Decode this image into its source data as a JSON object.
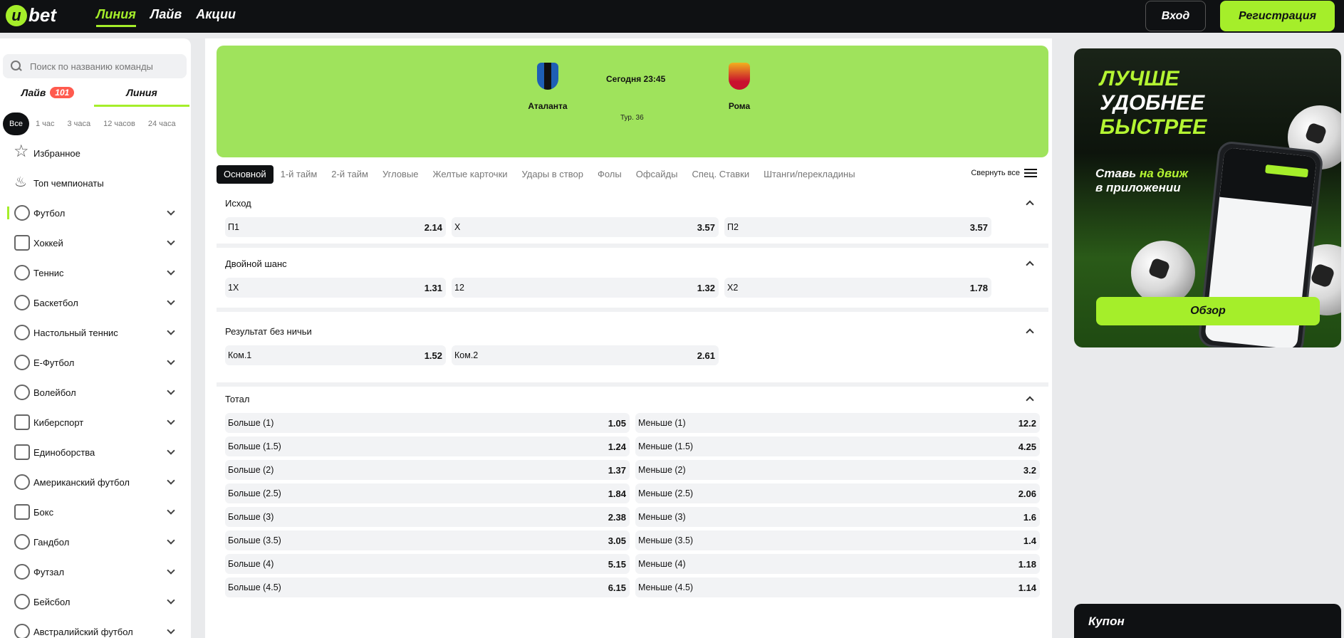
{
  "header": {
    "logo_text": "bet",
    "logo_letter": "u",
    "nav": [
      "Линия",
      "Лайв",
      "Акции"
    ],
    "login": "Вход",
    "register": "Регистрация"
  },
  "sidebar": {
    "search_placeholder": "Поиск по названию команды",
    "tab_live": "Лайв",
    "tab_live_count": "101",
    "tab_line": "Линия",
    "time_filters": [
      "Все",
      "1 час",
      "3 часа",
      "12 часов",
      "24 часа"
    ],
    "sports": [
      "Избранное",
      "Топ чемпионаты",
      "Футбол",
      "Хоккей",
      "Теннис",
      "Баскетбол",
      "Настольный теннис",
      "Е-Футбол",
      "Волейбол",
      "Киберспорт",
      "Единоборства",
      "Американский футбол",
      "Бокс",
      "Гандбол",
      "Футзал",
      "Бейсбол",
      "Австралийский футбол"
    ]
  },
  "match": {
    "home": "Аталанта",
    "away": "Рома",
    "time": "Сегодня 23:45",
    "round": "Тур. 36",
    "colors": {
      "banner": "#9fe35c",
      "home_crest": "#1e5fb5",
      "away_crest": "#c8102e"
    }
  },
  "market_tabs": [
    "Основной",
    "1-й тайм",
    "2-й тайм",
    "Угловые",
    "Желтые карточки",
    "Удары в створ",
    "Фолы",
    "Офсайды",
    "Спец. Ставки",
    "Штанги/перекладины"
  ],
  "collapse_all": "Свернуть все",
  "markets": {
    "outcome": {
      "title": "Исход",
      "odds": [
        [
          "П1",
          "2.14"
        ],
        [
          "X",
          "3.57"
        ],
        [
          "П2",
          "3.57"
        ]
      ]
    },
    "double": {
      "title": "Двойной шанс",
      "odds": [
        [
          "1X",
          "1.31"
        ],
        [
          "12",
          "1.32"
        ],
        [
          "X2",
          "1.78"
        ]
      ]
    },
    "nodraw": {
      "title": "Результат без ничьи",
      "odds": [
        [
          "Ком.1",
          "1.52"
        ],
        [
          "Ком.2",
          "2.61"
        ]
      ]
    },
    "total": {
      "title": "Тотал",
      "rows": [
        [
          [
            "Больше (1)",
            "1.05"
          ],
          [
            "Меньше (1)",
            "12.2"
          ]
        ],
        [
          [
            "Больше (1.5)",
            "1.24"
          ],
          [
            "Меньше (1.5)",
            "4.25"
          ]
        ],
        [
          [
            "Больше (2)",
            "1.37"
          ],
          [
            "Меньше (2)",
            "3.2"
          ]
        ],
        [
          [
            "Больше (2.5)",
            "1.84"
          ],
          [
            "Меньше (2.5)",
            "2.06"
          ]
        ],
        [
          [
            "Больше (3)",
            "2.38"
          ],
          [
            "Меньше (3)",
            "1.6"
          ]
        ],
        [
          [
            "Больше (3.5)",
            "3.05"
          ],
          [
            "Меньше (3.5)",
            "1.4"
          ]
        ],
        [
          [
            "Больше (4)",
            "5.15"
          ],
          [
            "Меньше (4)",
            "1.18"
          ]
        ],
        [
          [
            "Больше (4.5)",
            "6.15"
          ],
          [
            "Меньше (4.5)",
            "1.14"
          ]
        ]
      ]
    }
  },
  "promo": {
    "line1": "ЛУЧШЕ",
    "line2": "УДОБНЕЕ",
    "line3": "БЫСТРЕЕ",
    "sub_a": "Ставь ",
    "sub_b": "на движ",
    "sub_c": "в приложении",
    "button": "Обзор",
    "accent": "#a5ee2a"
  },
  "coupon": "Купон"
}
